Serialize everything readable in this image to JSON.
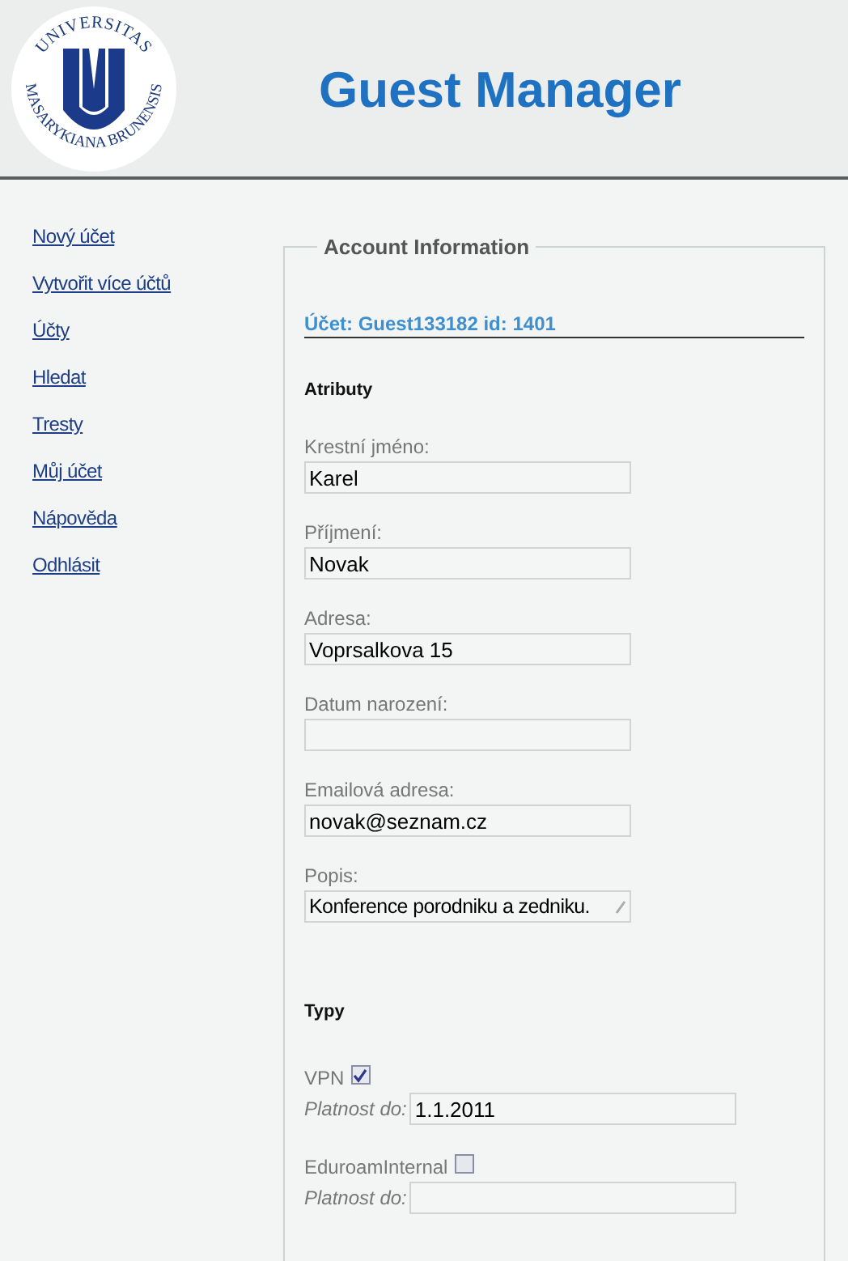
{
  "header": {
    "logo": {
      "top_text": "UNIVERSITAS",
      "bottom_text": "MASARYKIANA BRUNENSIS"
    },
    "title": "Guest Manager"
  },
  "sidebar": {
    "items": [
      {
        "label": "Nový účet"
      },
      {
        "label": "Vytvořit více účtů"
      },
      {
        "label": "Účty"
      },
      {
        "label": "Hledat"
      },
      {
        "label": "Tresty"
      },
      {
        "label": "Můj účet"
      },
      {
        "label": "Nápověda"
      },
      {
        "label": "Odhlásit"
      }
    ]
  },
  "account": {
    "legend": "Account Information",
    "heading": "Účet: Guest133182 id: 1401",
    "attributes_title": "Atributy",
    "fields": [
      {
        "label": "Krestní jméno:",
        "value": "Karel",
        "kind": "text"
      },
      {
        "label": "Příjmení:",
        "value": "Novak",
        "kind": "text"
      },
      {
        "label": "Adresa:",
        "value": "Voprsalkova 15",
        "kind": "text"
      },
      {
        "label": "Datum narození:",
        "kind": "text"
      },
      {
        "label": "Emailová adresa:",
        "value": "novak@seznam.cz",
        "kind": "text"
      },
      {
        "label": "Popis:",
        "value": "Konference porodniku a zedniku.",
        "kind": "textarea"
      }
    ],
    "types_title": "Typy",
    "types": [
      {
        "name": "VPN",
        "checked": true,
        "validity_label": "Platnost do:",
        "validity_value": "1.1.2011"
      },
      {
        "name": "EduroamInternal",
        "checked": false,
        "validity_label": "Platnost do:"
      }
    ]
  }
}
